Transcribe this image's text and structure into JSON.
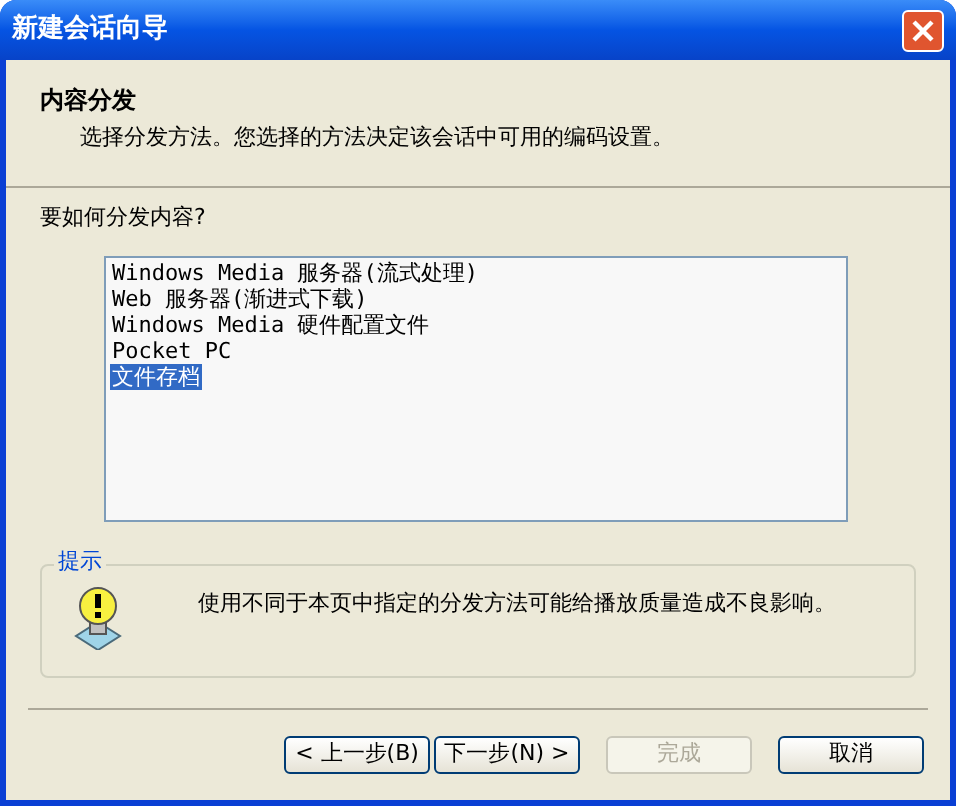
{
  "window": {
    "title": "新建会话向导"
  },
  "header": {
    "title": "内容分发",
    "subtitle": "选择分发方法。您选择的方法决定该会话中可用的编码设置。"
  },
  "question": "要如何分发内容?",
  "options": [
    {
      "label": "Windows Media 服务器(流式处理)",
      "selected": false
    },
    {
      "label": "Web 服务器(渐进式下载)",
      "selected": false
    },
    {
      "label": "Windows Media 硬件配置文件",
      "selected": false
    },
    {
      "label": "Pocket PC",
      "selected": false
    },
    {
      "label": "文件存档",
      "selected": true
    }
  ],
  "hint": {
    "legend": "提示",
    "text": "使用不同于本页中指定的分发方法可能给播放质量造成不良影响。"
  },
  "buttons": [
    {
      "label": "< 上一步(B)",
      "disabled": false
    },
    {
      "label": "下一步(N) >",
      "disabled": false
    },
    {
      "label": "完成",
      "disabled": true
    },
    {
      "label": "取消",
      "disabled": false
    }
  ]
}
